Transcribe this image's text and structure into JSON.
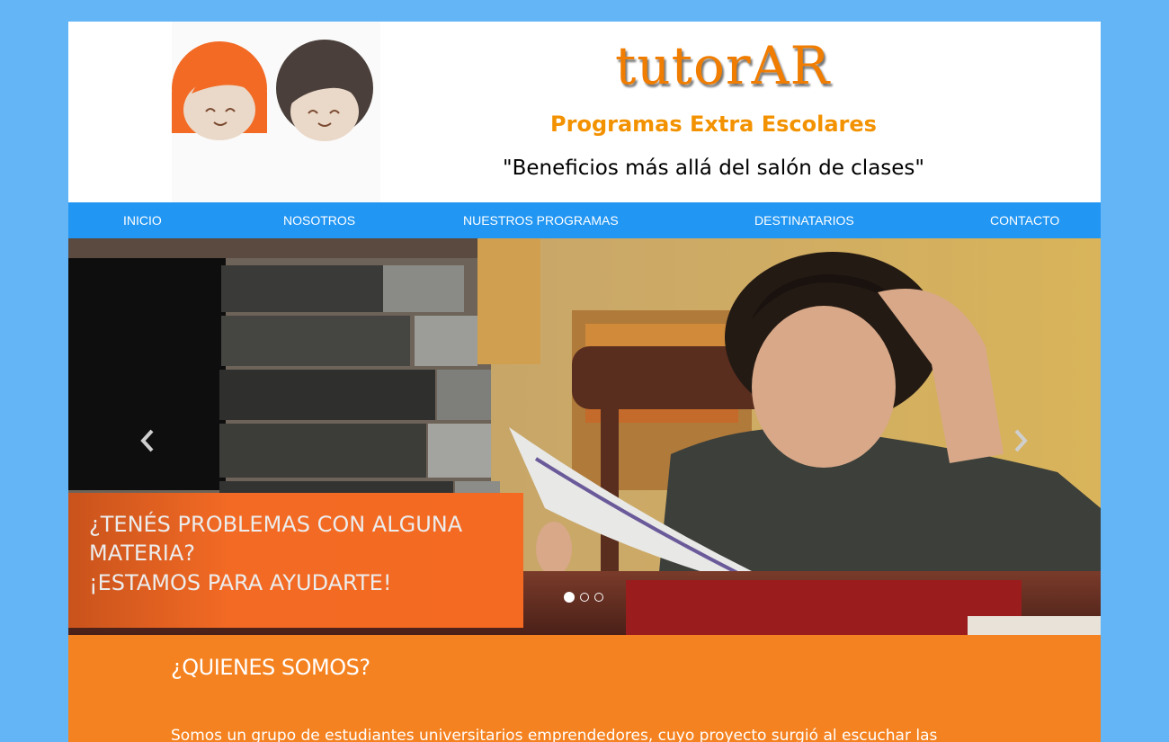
{
  "header": {
    "title": "tutorAR",
    "subtitle": "Programas Extra Escolares",
    "tagline": "\"Beneficios más allá del salón de clases\""
  },
  "nav": {
    "items": [
      {
        "label": "INICIO"
      },
      {
        "label": "NOSOTROS"
      },
      {
        "label": "NUESTROS PROGRAMAS"
      },
      {
        "label": "DESTINATARIOS"
      },
      {
        "label": "CONTACTO"
      }
    ]
  },
  "carousel": {
    "caption_lines": [
      "¿TENÉS PROBLEMAS CON ALGUNA",
      "MATERIA?",
      "¡ESTAMOS PARA AYUDARTE!"
    ],
    "active_slide": 1,
    "slide_count": 3
  },
  "about": {
    "title": "¿QUIENES SOMOS?",
    "text": "Somos un grupo de estudiantes universitarios emprendedores, cuyo proyecto surgió al escuchar las"
  },
  "colors": {
    "background": "#64b5f6",
    "nav": "#2196f3",
    "brand_orange": "#f07d00",
    "section_orange": "#f58220"
  }
}
